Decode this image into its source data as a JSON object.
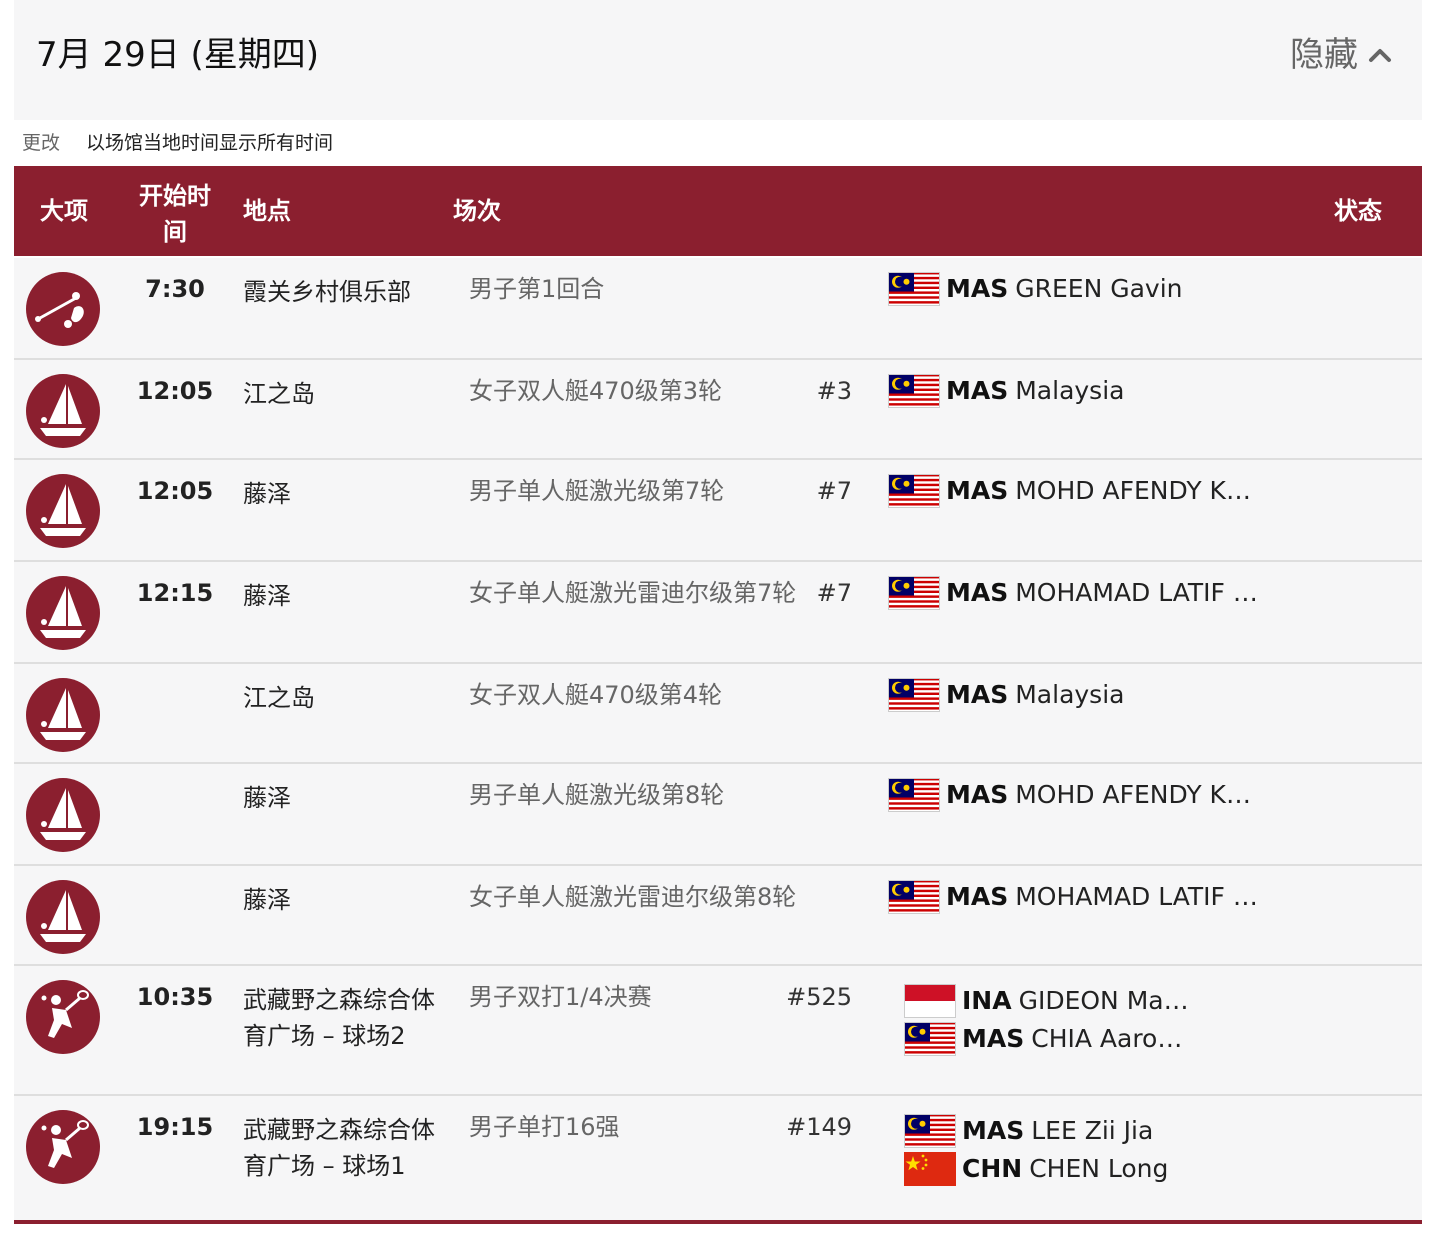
{
  "header": {
    "date": "7月 29日 (星期四)",
    "hide_label": "隐藏"
  },
  "timezone": {
    "change_label": "更改",
    "text": "以场馆当地时间显示所有时间"
  },
  "table": {
    "columns": {
      "sport": "大项",
      "start_time": "开始时间",
      "venue": "地点",
      "event": "场次",
      "status": "状态"
    },
    "rows": [
      {
        "sport_icon": "golf-icon",
        "time": "7:30",
        "venue": "霞关乡村俱乐部",
        "event": "男子第1回合",
        "number": "",
        "competitors": [
          {
            "flag": "mas",
            "noc": "MAS",
            "name": "GREEN Gavin"
          }
        ]
      },
      {
        "sport_icon": "sailing-icon",
        "time": "12:05",
        "venue": "江之岛",
        "event": "女子双人艇470级第3轮",
        "number": "#3",
        "competitors": [
          {
            "flag": "mas",
            "noc": "MAS",
            "name": "Malaysia"
          }
        ]
      },
      {
        "sport_icon": "sailing-icon",
        "time": "12:05",
        "venue": "藤泽",
        "event": "男子单人艇激光级第7轮",
        "number": "#7",
        "competitors": [
          {
            "flag": "mas",
            "noc": "MAS",
            "name": "MOHD AFENDY K…"
          }
        ]
      },
      {
        "sport_icon": "sailing-icon",
        "time": "12:15",
        "venue": "藤泽",
        "event": "女子单人艇激光雷迪尔级第7轮",
        "number": "#7",
        "competitors": [
          {
            "flag": "mas",
            "noc": "MAS",
            "name": "MOHAMAD LATIF …"
          }
        ]
      },
      {
        "sport_icon": "sailing-icon",
        "time": "",
        "venue": "江之岛",
        "event": "女子双人艇470级第4轮",
        "number": "",
        "competitors": [
          {
            "flag": "mas",
            "noc": "MAS",
            "name": "Malaysia"
          }
        ]
      },
      {
        "sport_icon": "sailing-icon",
        "time": "",
        "venue": "藤泽",
        "event": "男子单人艇激光级第8轮",
        "number": "",
        "competitors": [
          {
            "flag": "mas",
            "noc": "MAS",
            "name": "MOHD AFENDY K…"
          }
        ]
      },
      {
        "sport_icon": "sailing-icon",
        "time": "",
        "venue": "藤泽",
        "event": "女子单人艇激光雷迪尔级第8轮",
        "number": "",
        "competitors": [
          {
            "flag": "mas",
            "noc": "MAS",
            "name": "MOHAMAD LATIF …"
          }
        ]
      },
      {
        "sport_icon": "badminton-icon",
        "time": "10:35",
        "venue": "武藏野之森综合体育广场 – 球场2",
        "event": "男子双打1/4决赛",
        "number": "#525",
        "competitors": [
          {
            "flag": "ina",
            "noc": "INA",
            "name": "GIDEON Ma…"
          },
          {
            "flag": "mas",
            "noc": "MAS",
            "name": "CHIA Aaro…"
          }
        ]
      },
      {
        "sport_icon": "badminton-icon",
        "time": "19:15",
        "venue": "武藏野之森综合体育广场 – 球场1",
        "event": "男子单打16强",
        "number": "#149",
        "competitors": [
          {
            "flag": "mas",
            "noc": "MAS",
            "name": "LEE Zii Jia"
          },
          {
            "flag": "chn",
            "noc": "CHN",
            "name": "CHEN Long"
          }
        ]
      }
    ]
  },
  "colors": {
    "accent": "#8b1f2f",
    "row_bg": "#f6f6f7"
  }
}
